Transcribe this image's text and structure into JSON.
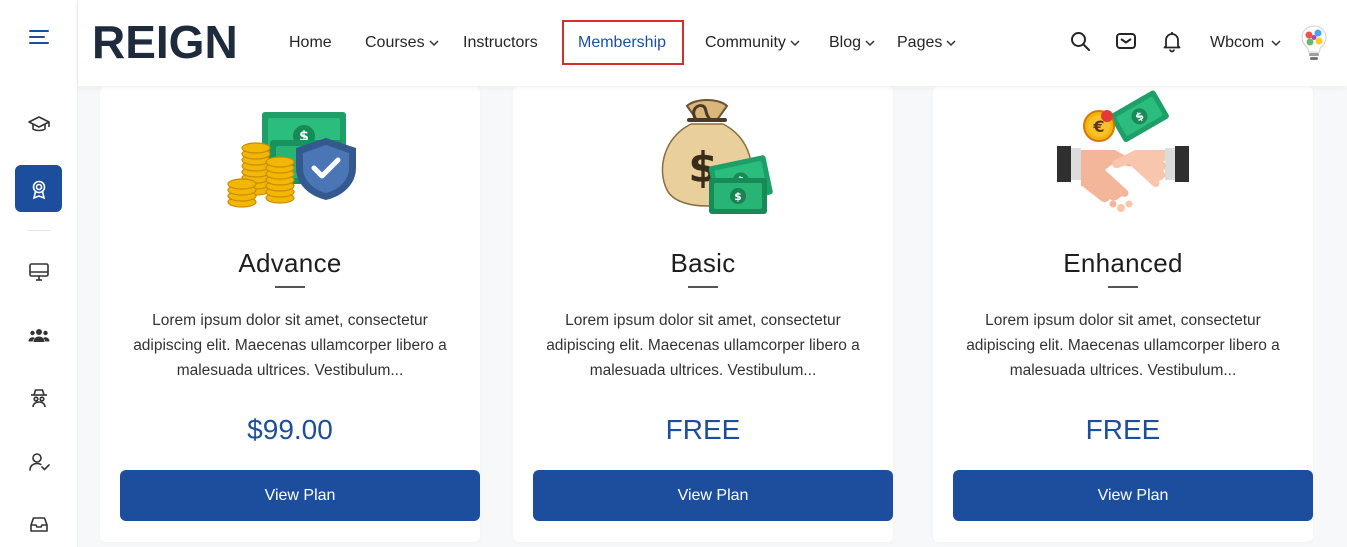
{
  "header": {
    "logo_text": "REIGN",
    "nav": [
      {
        "label": "Home",
        "has_dropdown": false
      },
      {
        "label": "Courses",
        "has_dropdown": true
      },
      {
        "label": "Instructors",
        "has_dropdown": false
      },
      {
        "label": "Membership",
        "has_dropdown": false,
        "active": true
      },
      {
        "label": "Community",
        "has_dropdown": true
      },
      {
        "label": "Blog",
        "has_dropdown": true
      },
      {
        "label": "Pages",
        "has_dropdown": true
      }
    ],
    "icons": [
      "search-icon",
      "mail-icon",
      "bell-icon"
    ],
    "user_name": "Wbcom"
  },
  "sidebar": {
    "items": [
      {
        "icon": "menu-icon"
      },
      {
        "icon": "graduation-cap-icon"
      },
      {
        "icon": "award-badge-icon",
        "active": true
      },
      {
        "icon": "monitor-icon"
      },
      {
        "icon": "groups-icon"
      },
      {
        "icon": "spy-incognito-icon"
      },
      {
        "icon": "user-check-icon"
      },
      {
        "icon": "inbox-icon"
      }
    ]
  },
  "plans": [
    {
      "title": "Advance",
      "illustration": "money-shield-icon",
      "description": "Lorem ipsum dolor sit amet, consectetur adipiscing elit. Maecenas ullamcorper libero a malesuada ultrices. Vestibulum...",
      "price": "$99.00",
      "button": "View Plan"
    },
    {
      "title": "Basic",
      "illustration": "money-bag-icon",
      "description": "Lorem ipsum dolor sit amet, consectetur adipiscing elit. Maecenas ullamcorper libero a malesuada ultrices. Vestibulum...",
      "price": "FREE",
      "button": "View Plan"
    },
    {
      "title": "Enhanced",
      "illustration": "handshake-money-icon",
      "description": "Lorem ipsum dolor sit amet, consectetur adipiscing elit. Maecenas ullamcorper libero a malesuada ultrices. Vestibulum...",
      "price": "FREE",
      "button": "View Plan"
    }
  ],
  "colors": {
    "accent": "#1d4e9e",
    "highlight_border": "#d32f2f",
    "background": "#f7f8fa"
  }
}
